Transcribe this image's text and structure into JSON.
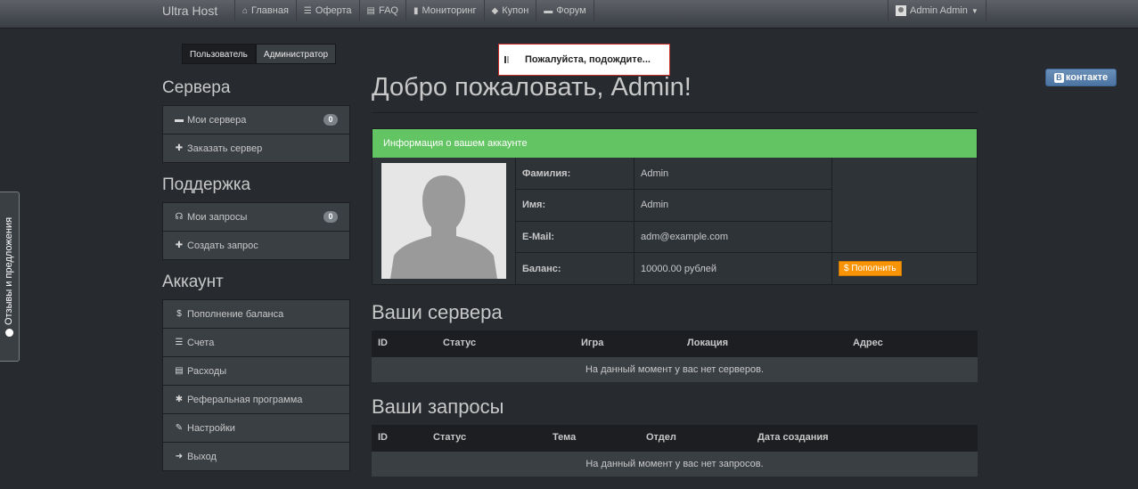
{
  "navbar": {
    "brand": "Ultra Host",
    "items": [
      {
        "label": "Главная",
        "icon": "home-icon",
        "glyph": "⌂"
      },
      {
        "label": "Оферта",
        "icon": "list-icon",
        "glyph": "☰"
      },
      {
        "label": "FAQ",
        "icon": "book-icon",
        "glyph": "▤"
      },
      {
        "label": "Мониторинг",
        "icon": "bar-chart-icon",
        "glyph": "▮"
      },
      {
        "label": "Купон",
        "icon": "tag-icon",
        "glyph": "◆"
      },
      {
        "label": "Форум",
        "icon": "comment-icon",
        "glyph": "▬"
      }
    ],
    "user": "Admin Admin"
  },
  "role_switch": {
    "user": "Пользователь",
    "admin": "Администратор"
  },
  "loading": {
    "text": "Пожалуйста, подождите..."
  },
  "vk": {
    "logo": "B",
    "label": "контакте"
  },
  "feedback": {
    "label": "Отзывы и предложения"
  },
  "sidebar": {
    "servers": {
      "heading": "Сервера",
      "items": [
        {
          "label": "Мои сервера",
          "icon": "server-icon",
          "glyph": "▬",
          "badge": "0"
        },
        {
          "label": "Заказать сервер",
          "icon": "plus-icon",
          "glyph": "✚"
        }
      ]
    },
    "support": {
      "heading": "Поддержка",
      "items": [
        {
          "label": "Мои запросы",
          "icon": "headphones-icon",
          "glyph": "☊",
          "badge": "0"
        },
        {
          "label": "Создать запрос",
          "icon": "plus-icon",
          "glyph": "✚"
        }
      ]
    },
    "account": {
      "heading": "Аккаунт",
      "items": [
        {
          "label": "Пополнение баланса",
          "icon": "dollar-icon",
          "glyph": "$"
        },
        {
          "label": "Счета",
          "icon": "list-icon",
          "glyph": "☰"
        },
        {
          "label": "Расходы",
          "icon": "ledger-icon",
          "glyph": "▤"
        },
        {
          "label": "Реферальная программа",
          "icon": "asterisk-icon",
          "glyph": "✱"
        },
        {
          "label": "Настройки",
          "icon": "wrench-icon",
          "glyph": "✎"
        },
        {
          "label": "Выход",
          "icon": "logout-icon",
          "glyph": "➜"
        }
      ]
    }
  },
  "main": {
    "title": "Добро пожаловать, Admin!",
    "account_panel": {
      "heading": "Информация о вашем аккаунте",
      "rows": [
        {
          "label": "Фамилия:",
          "value": "Admin"
        },
        {
          "label": "Имя:",
          "value": "Admin"
        },
        {
          "label": "E-Mail:",
          "value": "adm@example.com"
        },
        {
          "label": "Баланс:",
          "value": "10000.00 рублей"
        }
      ],
      "topup_label": "$ Пополнить"
    },
    "servers": {
      "title": "Ваши сервера",
      "columns": [
        "ID",
        "Статус",
        "Игра",
        "Локация",
        "Адрес"
      ],
      "empty": "На данный момент у вас нет серверов."
    },
    "requests": {
      "title": "Ваши запросы",
      "columns": [
        "ID",
        "Статус",
        "Тема",
        "Отдел",
        "Дата создания"
      ],
      "empty": "На данный момент у вас нет запросов."
    }
  },
  "colors": {
    "background": "#272b30",
    "panel_success": "#62c462",
    "warning": "#f89406",
    "vk": "#4c75a3",
    "loading_border": "#c9302c"
  }
}
